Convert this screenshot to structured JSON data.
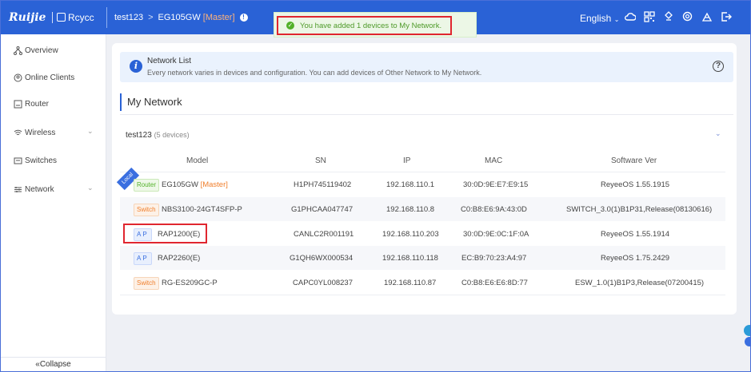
{
  "topbar": {
    "logo_ruijie": "Ruijie",
    "logo_rcycc": "Rcycc",
    "breadcrumb_network": "test123",
    "breadcrumb_separator": ">",
    "breadcrumb_device": "EG105GW",
    "breadcrumb_role": "[Master]",
    "language": "English",
    "icons": [
      "cloud-icon",
      "qr-code-icon",
      "alert-icon",
      "search-icon",
      "tools-icon",
      "logout-icon"
    ]
  },
  "toast": {
    "message": "You have added 1 devices to My Network."
  },
  "sidebar": {
    "items": [
      {
        "label": "Overview",
        "icon": "topology-icon"
      },
      {
        "label": "Online Clients",
        "icon": "clients-icon"
      },
      {
        "label": "Router",
        "icon": "router-icon"
      },
      {
        "label": "Wireless",
        "icon": "wifi-icon"
      },
      {
        "label": "Switches",
        "icon": "switch-icon"
      },
      {
        "label": "Network",
        "icon": "network-icon"
      }
    ],
    "collapse_label": "Collapse"
  },
  "network_list": {
    "title": "Network List",
    "description": "Every network varies in devices and configuration. You can add devices of Other Network to My Network."
  },
  "my_network": {
    "title": "My Network",
    "group_name": "test123",
    "group_count": "(5 devices)",
    "columns": [
      "Model",
      "SN",
      "IP",
      "MAC",
      "Software Ver"
    ],
    "local_badge": "Local",
    "rows": [
      {
        "tag": "Router",
        "model": "EG105GW",
        "role": "[Master]",
        "sn": "H1PH745119402",
        "ip": "192.168.110.1",
        "mac": "30:0D:9E:E7:E9:15",
        "software": "ReyeeOS 1.55.1915"
      },
      {
        "tag": "Switch",
        "model": "NBS3100-24GT4SFP-P",
        "role": "",
        "sn": "G1PHCAA047747",
        "ip": "192.168.110.8",
        "mac": "C0:B8:E6:9A:43:0D",
        "software": "SWITCH_3.0(1)B1P31,Release(08130616)"
      },
      {
        "tag": "AP",
        "model": "RAP1200(E)",
        "role": "",
        "sn": "CANLC2R001191",
        "ip": "192.168.110.203",
        "mac": "30:0D:9E:0C:1F:0A",
        "software": "ReyeeOS 1.55.1914"
      },
      {
        "tag": "AP",
        "model": "RAP2260(E)",
        "role": "",
        "sn": "G1QH6WX000534",
        "ip": "192.168.110.118",
        "mac": "EC:B9:70:23:A4:97",
        "software": "ReyeeOS 1.75.2429"
      },
      {
        "tag": "Switch",
        "model": "RG-ES209GC-P",
        "role": "",
        "sn": "CAPC0YL008237",
        "ip": "192.168.110.87",
        "mac": "C0:B8:E6:E6:8D:77",
        "software": "ESW_1.0(1)B1P3,Release(07200415)"
      }
    ]
  },
  "colors": {
    "brand_blue": "#2a62d6",
    "success_green": "#52b129",
    "highlight_red": "#e0262f",
    "master_orange": "#f07e2b"
  }
}
